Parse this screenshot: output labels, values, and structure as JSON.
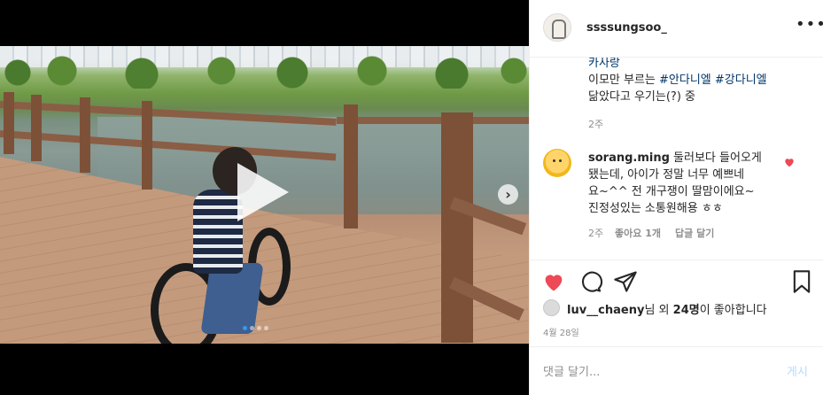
{
  "post": {
    "username": "ssssungsoo_",
    "more_icon": "more-horizontal-icon"
  },
  "comments": [
    {
      "lines": [
        "카사랑",
        "이모만 부르는 ",
        "#안다니엘",
        " ",
        "#강다니엘",
        "닮았다고 우기는(?) 중"
      ],
      "time": "2주"
    },
    {
      "username": "sorang.ming",
      "text_line1": " 둘러보다 들어오게",
      "text_line2": "됐는데, 아이가 정말 너무 예쁘네",
      "text_line3": "요~^^ 전 개구쟁이 딸맘이에요~",
      "text_line4": "진정성있는 소통원해용 ㅎㅎ",
      "time": "2주",
      "likes": "좋아요 1개",
      "reply": "답글 달기",
      "liked": true
    }
  ],
  "likes": {
    "user": "luv__chaeny",
    "suffix1": "님 외 ",
    "count": "24명",
    "suffix2": "이 좋아합니다"
  },
  "date": "4월 28일",
  "add_comment": {
    "placeholder": "댓글 달기...",
    "post_label": "게시"
  },
  "colors": {
    "like_red": "#ed4956",
    "link_blue": "#003569",
    "post_disabled": "#b3dbff",
    "slide_dot_active": "#3897f0"
  },
  "media": {
    "slide_count": 4,
    "active_slide": 1
  }
}
